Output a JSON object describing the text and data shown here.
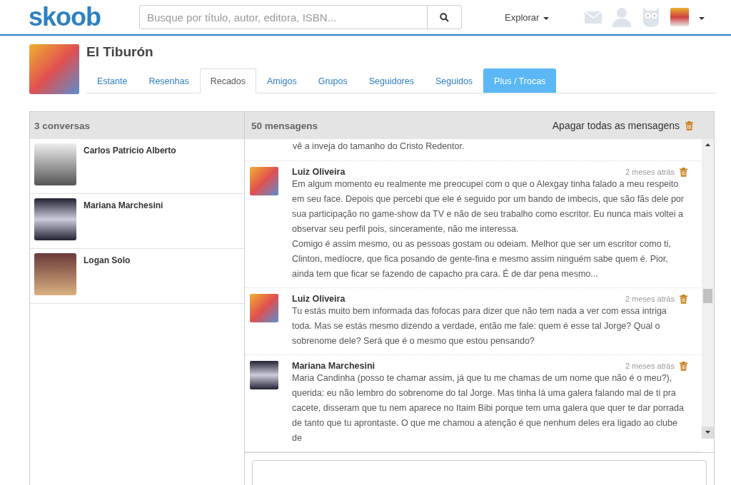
{
  "header": {
    "logo": "skoob",
    "search": {
      "placeholder": "Busque por título, autor, editora, ISBN..."
    },
    "explore": "Explorar"
  },
  "profile": {
    "name": "El Tiburón"
  },
  "tabs": [
    {
      "label": "Estante",
      "selected": false,
      "kind": "normal"
    },
    {
      "label": "Resenhas",
      "selected": false,
      "kind": "normal"
    },
    {
      "label": "Recados",
      "selected": true,
      "kind": "normal"
    },
    {
      "label": "Amigos",
      "selected": false,
      "kind": "normal"
    },
    {
      "label": "Grupos",
      "selected": false,
      "kind": "normal"
    },
    {
      "label": "Seguidores",
      "selected": false,
      "kind": "normal"
    },
    {
      "label": "Seguidos",
      "selected": false,
      "kind": "normal"
    },
    {
      "label": "Plus / Trocas",
      "selected": false,
      "kind": "highlight"
    }
  ],
  "conversations": {
    "title": "3 conversas",
    "items": [
      {
        "name": "Carlos Patricio Alberto"
      },
      {
        "name": "Mariana Marchesini"
      },
      {
        "name": "Logan Solo"
      }
    ]
  },
  "messages": {
    "title": "50 mensagens",
    "delete_all": "Apagar todas as mensagens",
    "partial_text": "vê a inveja do tamanho do Cristo Redentor.",
    "items": [
      {
        "author": "Luiz Oliveira",
        "time": "2 meses atrás",
        "paragraphs": [
          "Em algum momento eu realmente me preocupei com o que o Alexgay tinha falado a meu respeito em seu face. Depois que percebi que ele é seguido por um bando de imbecis, que são fãs dele por sua participação no game-show da TV e não de seu trabalho como escritor. Eu nunca mais voltei a observar seu perfil pois, sinceramente, não me interessa.",
          "Comigo é assim mesmo, ou as pessoas gostam ou odeiam. Melhor que ser um escritor como ti, Clinton, medíocre, que fica posando de gente-fina e mesmo assim ninguém sabe quem é. Pior, ainda tem que ficar se fazendo de capacho pra cara. É de dar pena mesmo..."
        ]
      },
      {
        "author": "Luiz Oliveira",
        "time": "2 meses atrás",
        "paragraphs": [
          "Tu estás muito bem informada das fofocas para dizer que não tem nada a ver com essa intriga toda. Mas se estás mesmo dizendo a verdade, então me fale: quem é esse tal Jorge? Qual o sobrenome dele? Será que é o mesmo que estou pensando?"
        ]
      },
      {
        "author": "Mariana Marchesini",
        "time": "2 meses atrás",
        "paragraphs": [
          "Maria Candinha (posso te chamar assim, já que tu me chamas de um nome que não é o meu?), querida: eu não lembro do sobrenome do tal Jorge. Mas tinha lá uma galera falando mal de ti pra cacete, disseram que tu nem aparece no Itaim Bibi porque tem uma galera que quer te dar porrada de tanto que tu aprontaste. O que me chamou a atenção é que nenhum deles era ligado ao clube de"
        ]
      }
    ]
  }
}
